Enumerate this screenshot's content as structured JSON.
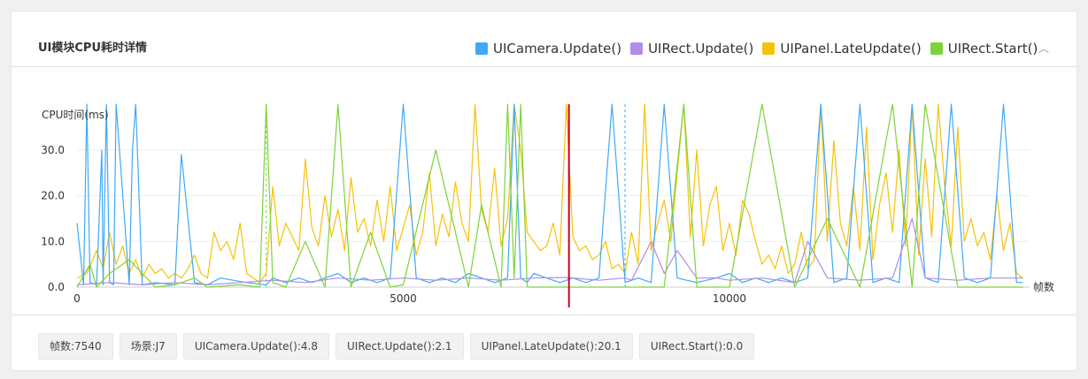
{
  "panel": {
    "title": "UI模块CPU耗时详情",
    "collapse_glyph": "︿"
  },
  "legend": [
    {
      "label": "UICamera.Update()",
      "color": "#3fa9f5"
    },
    {
      "label": "UIRect.Update()",
      "color": "#b28ce8"
    },
    {
      "label": "UIPanel.LateUpdate()",
      "color": "#f5c20b"
    },
    {
      "label": "UIRect.Start()",
      "color": "#7cd33b"
    }
  ],
  "footer_tags": [
    "帧数:7540",
    "场景:J7",
    "UICamera.Update():4.8",
    "UIRect.Update():2.1",
    "UIPanel.LateUpdate():20.1",
    "UIRect.Start():0.0"
  ],
  "chart_data": {
    "type": "line",
    "ylabel": "CPU时间(ms)",
    "xlabel": "帧数",
    "xlim": [
      0,
      14600
    ],
    "ylim": [
      0,
      40
    ],
    "y_ticks": [
      "0.0",
      "10.0",
      "20.0",
      "30.0"
    ],
    "y_tick_values": [
      0,
      10,
      20,
      30
    ],
    "x_ticks": [
      "0",
      "5000",
      "10000"
    ],
    "x_tick_values": [
      0,
      5000,
      10000
    ],
    "grid": "horizontal",
    "marker_frame": 7540,
    "marker_color": "#d0021b",
    "dashed_markers": [
      {
        "frame": 2900,
        "color": "#7cd33b"
      },
      {
        "frame": 8400,
        "color": "#3fa9f5"
      }
    ],
    "series": [
      {
        "name": "UIPanel.LateUpdate()",
        "color": "#f5c20b",
        "x": [
          0,
          150,
          300,
          400,
          500,
          600,
          700,
          800,
          900,
          1000,
          1100,
          1200,
          1300,
          1400,
          1500,
          1600,
          1700,
          1800,
          1900,
          2000,
          2100,
          2200,
          2300,
          2400,
          2500,
          2600,
          2700,
          2800,
          2900,
          3000,
          3100,
          3200,
          3300,
          3400,
          3500,
          3600,
          3700,
          3800,
          3900,
          4000,
          4100,
          4200,
          4300,
          4400,
          4500,
          4600,
          4700,
          4800,
          4900,
          5000,
          5100,
          5200,
          5300,
          5400,
          5500,
          5600,
          5700,
          5800,
          5900,
          6000,
          6100,
          6200,
          6300,
          6400,
          6500,
          6600,
          6700,
          6800,
          6900,
          7000,
          7100,
          7200,
          7300,
          7400,
          7500,
          7600,
          7700,
          7800,
          7900,
          8000,
          8100,
          8200,
          8300,
          8400,
          8500,
          8600,
          8700,
          8800,
          8900,
          9000,
          9100,
          9200,
          9300,
          9400,
          9500,
          9600,
          9700,
          9800,
          9900,
          10000,
          10100,
          10200,
          10300,
          10400,
          10500,
          10600,
          10700,
          10800,
          10900,
          11000,
          11100,
          11200,
          11300,
          11400,
          11500,
          11600,
          11700,
          11800,
          11900,
          12000,
          12100,
          12200,
          12300,
          12400,
          12500,
          12600,
          12700,
          12800,
          12900,
          13000,
          13100,
          13200,
          13300,
          13400,
          13500,
          13600,
          13700,
          13800,
          13900,
          14000,
          14100,
          14200,
          14300,
          14400,
          14500
        ],
        "values": [
          2,
          3,
          8,
          4,
          12,
          5,
          9,
          3,
          6,
          2,
          5,
          3,
          4,
          2,
          3,
          2,
          4,
          7,
          3,
          2,
          12,
          8,
          10,
          6,
          14,
          3,
          2,
          1,
          3,
          22,
          9,
          14,
          11,
          8,
          28,
          13,
          9,
          20,
          11,
          17,
          8,
          24,
          12,
          15,
          9,
          19,
          10,
          22,
          8,
          13,
          18,
          7,
          12,
          25,
          9,
          16,
          11,
          23,
          14,
          10,
          40,
          17,
          12,
          26,
          9,
          15,
          40,
          30,
          12,
          10,
          8,
          9,
          14,
          7,
          40,
          11,
          8,
          9,
          6,
          7,
          10,
          4,
          5,
          3,
          12,
          5,
          40,
          8,
          14,
          19,
          10,
          25,
          40,
          11,
          30,
          9,
          18,
          22,
          8,
          14,
          7,
          19,
          16,
          10,
          5,
          7,
          4,
          9,
          3,
          5,
          12,
          4,
          6,
          40,
          10,
          32,
          14,
          9,
          22,
          8,
          35,
          6,
          18,
          25,
          12,
          30,
          9,
          40,
          7,
          28,
          11,
          40,
          22,
          9,
          35,
          10,
          15,
          9,
          12,
          6,
          20,
          8,
          14,
          3,
          2
        ]
      },
      {
        "name": "UICamera.Update()",
        "color": "#3fa9f5",
        "x": [
          0,
          100,
          150,
          200,
          300,
          380,
          400,
          450,
          500,
          560,
          600,
          800,
          850,
          900,
          1000,
          1200,
          1500,
          1600,
          1800,
          2000,
          2200,
          2600,
          2900,
          3000,
          3200,
          3400,
          3600,
          3800,
          4000,
          4200,
          4400,
          4600,
          4800,
          5000,
          5200,
          5400,
          5600,
          5800,
          6000,
          6200,
          6400,
          6600,
          6700,
          6800,
          6900,
          7000,
          7200,
          7400,
          7600,
          7800,
          8000,
          8200,
          8400,
          8600,
          8800,
          9000,
          9200,
          9500,
          9800,
          10000,
          10200,
          10400,
          10600,
          10800,
          11000,
          11200,
          11400,
          11600,
          11800,
          12000,
          12200,
          12400,
          12600,
          12800,
          13000,
          13200,
          13400,
          13600,
          13800,
          14000,
          14200,
          14400,
          14500
        ],
        "values": [
          14,
          0.5,
          40,
          1,
          0.5,
          30,
          0.5,
          40,
          1,
          0.5,
          40,
          0.5,
          30,
          40,
          0.5,
          1,
          0.5,
          29,
          1,
          0.5,
          2,
          1,
          0.5,
          2,
          1,
          2,
          1,
          2,
          3,
          1,
          2,
          1,
          2,
          40,
          2,
          1,
          2,
          1,
          3,
          2,
          1,
          2,
          40,
          2,
          1,
          3,
          2,
          1,
          2,
          1,
          2,
          40,
          1,
          2,
          1,
          40,
          2,
          1,
          2,
          3,
          1,
          2,
          1,
          2,
          1,
          2,
          40,
          1,
          2,
          40,
          1,
          2,
          1,
          40,
          2,
          1,
          40,
          2,
          1,
          2,
          40,
          1,
          1
        ]
      },
      {
        "name": "UIRect.Update()",
        "color": "#b28ce8",
        "x": [
          0,
          500,
          1000,
          1500,
          2000,
          2500,
          3000,
          3500,
          4000,
          4500,
          5000,
          5500,
          6000,
          6500,
          7000,
          7500,
          8000,
          8400,
          8500,
          8800,
          9000,
          9200,
          9500,
          9800,
          10000,
          10500,
          11000,
          11200,
          11500,
          12000,
          12500,
          12800,
          13000,
          13500,
          14000,
          14500
        ],
        "values": [
          0.5,
          1,
          0.5,
          1,
          0.5,
          1,
          1.5,
          1,
          2,
          1.5,
          2,
          1.5,
          2,
          1.5,
          2,
          2.1,
          1.5,
          2,
          1.5,
          10,
          3,
          8,
          2,
          2,
          1.5,
          2,
          1,
          10,
          2,
          1.5,
          2,
          15,
          2,
          1.5,
          2,
          2
        ]
      },
      {
        "name": "UIRect.Start()",
        "color": "#7cd33b",
        "x": [
          0,
          200,
          300,
          500,
          800,
          1200,
          1500,
          1800,
          2000,
          2500,
          2800,
          2900,
          3000,
          3200,
          3500,
          3800,
          4000,
          4200,
          4500,
          4800,
          5000,
          5500,
          6000,
          6200,
          6500,
          6600,
          6700,
          6800,
          6900,
          7000,
          7500,
          8000,
          8500,
          9000,
          9300,
          9500,
          10000,
          10500,
          11000,
          11500,
          12000,
          12500,
          12800,
          13000,
          13500,
          14000,
          14500
        ],
        "values": [
          0,
          5,
          0,
          3,
          6,
          0,
          0.5,
          2,
          0,
          0.5,
          0,
          40,
          1,
          0,
          10,
          0,
          40,
          0,
          12,
          0,
          0.5,
          30,
          0,
          18,
          0,
          40,
          2,
          40,
          0,
          0,
          0,
          0,
          0,
          0,
          40,
          0,
          0,
          40,
          0,
          15,
          0,
          40,
          0,
          40,
          0,
          0,
          0
        ]
      }
    ]
  }
}
